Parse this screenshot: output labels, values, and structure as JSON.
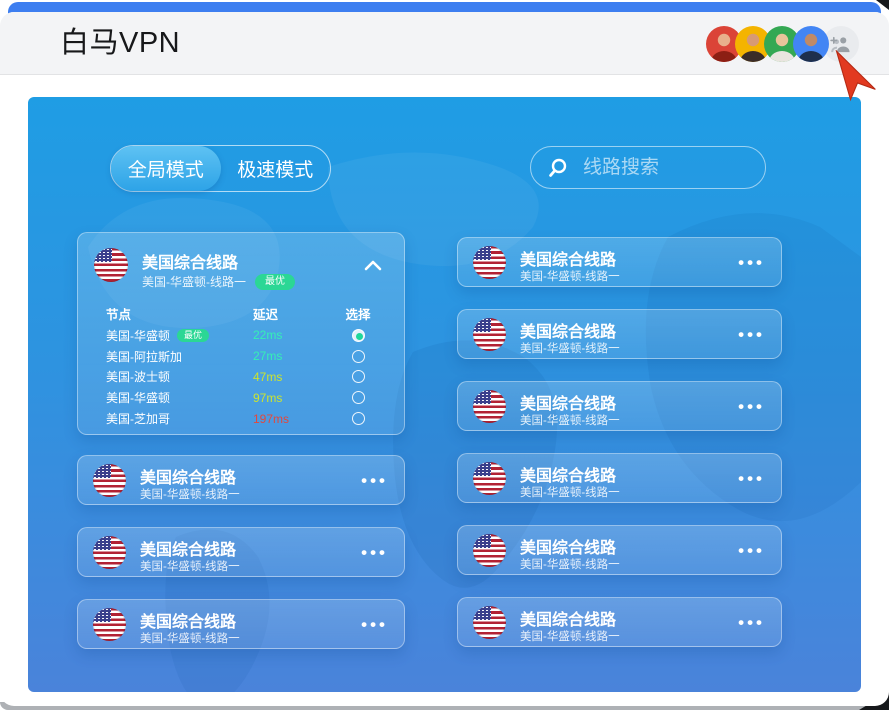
{
  "app": {
    "title": "白马VPN"
  },
  "header": {
    "avatars": [
      {
        "name": "avatar-1",
        "bg": "#db4437"
      },
      {
        "name": "avatar-2",
        "bg": "#f4b400"
      },
      {
        "name": "avatar-3",
        "bg": "#34a853"
      },
      {
        "name": "avatar-4",
        "bg": "#4285f4"
      }
    ],
    "add_user": {
      "bg": "#e9ebee"
    }
  },
  "panel": {
    "tabs": [
      {
        "label": "全局模式",
        "active": true
      },
      {
        "label": "极速模式",
        "active": false
      }
    ],
    "search": {
      "placeholder": "线路搜索"
    },
    "expanded_card": {
      "title": "美国综合线路",
      "subtitle": "美国-华盛顿-线路一",
      "badge": "最优",
      "table": {
        "headers": {
          "node": "节点",
          "latency": "延迟",
          "select": "选择"
        },
        "rows": [
          {
            "node": "美国-华盛顿",
            "badge": "最优",
            "latency": "22ms",
            "latency_color": "#35f0b5",
            "selected": true
          },
          {
            "node": "美国-阿拉斯加",
            "latency": "27ms",
            "latency_color": "#35f0b5",
            "selected": false
          },
          {
            "node": "美国-波士顿",
            "latency": "47ms",
            "latency_color": "#cbe42f",
            "selected": false
          },
          {
            "node": "美国-华盛顿",
            "latency": "97ms",
            "latency_color": "#cbe42f",
            "selected": false
          },
          {
            "node": "美国-芝加哥",
            "latency": "197ms",
            "latency_color": "#e2483d",
            "selected": false
          }
        ]
      }
    },
    "line_card": {
      "title": "美国综合线路",
      "subtitle": "美国-华盛顿-线路一",
      "menu": "•••"
    },
    "left_collapsed_count": 3,
    "right_collapsed_count": 6
  },
  "colors": {
    "top_bar": "#3d7ef0",
    "panel_top": "#1f9de4",
    "panel_bottom": "#4a83da",
    "badge_green": "#2bd795",
    "cursor_red": "#e23a20"
  }
}
